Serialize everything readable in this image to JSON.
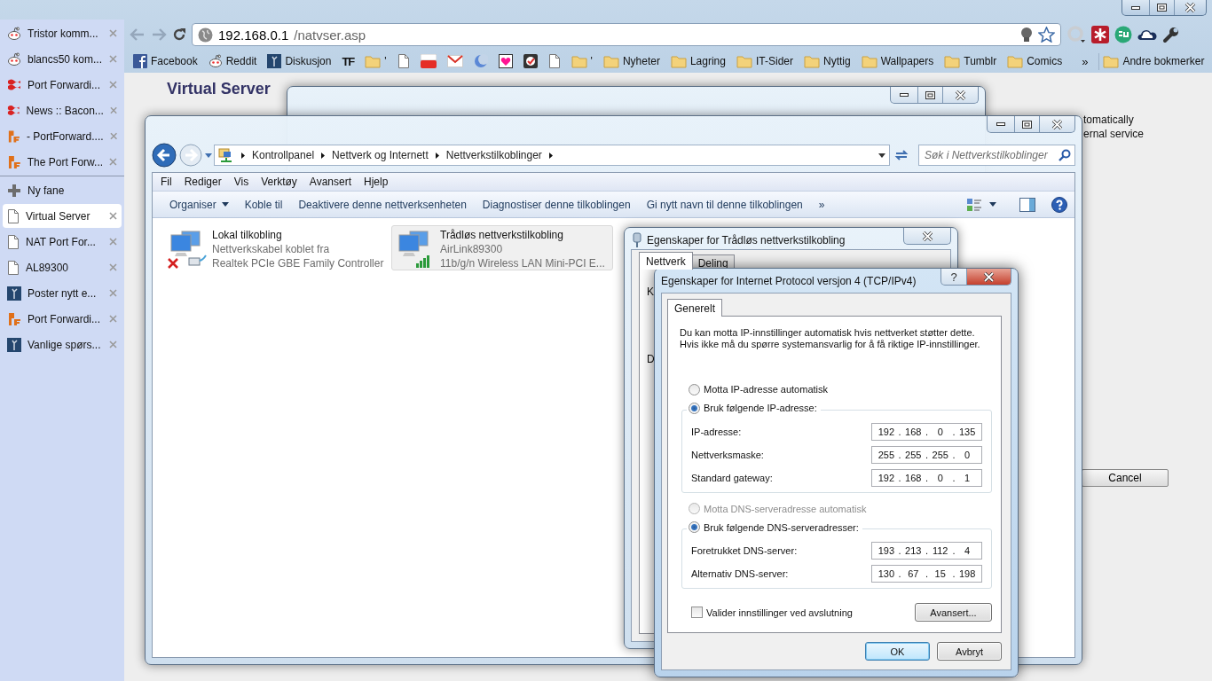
{
  "browser": {
    "tabs": [
      {
        "title": "Tristor komm...",
        "kind": "alien",
        "selected": false
      },
      {
        "title": "blancs50 kom...",
        "kind": "alien",
        "selected": false
      },
      {
        "title": "Port Forwardi...",
        "kind": "stripes",
        "selected": false
      },
      {
        "title": "News :: Bacon...",
        "kind": "stripes",
        "selected": false
      },
      {
        "title": "- PortForward....",
        "kind": "logo",
        "selected": false
      },
      {
        "title": "The Port Forw...",
        "kind": "logo",
        "selected": false
      }
    ],
    "new_tab": "Ny fane",
    "more_tabs": [
      {
        "title": "Virtual Server",
        "kind": "page",
        "selected": true
      },
      {
        "title": "NAT Port For...",
        "kind": "page",
        "selected": false
      },
      {
        "title": "AL89300",
        "kind": "page",
        "selected": false
      },
      {
        "title": "Poster nytt e...",
        "kind": "tile",
        "selected": false
      },
      {
        "title": "Port Forwardi...",
        "kind": "logo",
        "selected": false
      },
      {
        "title": "Vanlige spørs...",
        "kind": "tile",
        "selected": false
      }
    ],
    "url": {
      "host": "192.168.0.1",
      "path": "/natvser.asp"
    },
    "bookmarks": [
      {
        "label": "Facebook",
        "kind": "fb"
      },
      {
        "label": "Reddit",
        "kind": "alien"
      },
      {
        "label": "Diskusjon",
        "kind": "tile"
      },
      {
        "label": "TF",
        "kind": "text"
      },
      {
        "label": "'",
        "kind": "folder"
      },
      {
        "kind": "page"
      },
      {
        "kind": "video"
      },
      {
        "kind": "mail"
      },
      {
        "kind": "crescent"
      },
      {
        "kind": "heart"
      },
      {
        "kind": "check"
      },
      {
        "kind": "page"
      },
      {
        "label": "'",
        "kind": "folder"
      },
      {
        "label": "Nyheter",
        "kind": "folder"
      },
      {
        "label": "Lagring",
        "kind": "folder"
      },
      {
        "label": "IT-Sider",
        "kind": "folder"
      },
      {
        "label": "Nyttig",
        "kind": "folder"
      },
      {
        "label": "Wallpapers",
        "kind": "folder"
      },
      {
        "label": "Tumblr",
        "kind": "folder"
      },
      {
        "label": "Comics",
        "kind": "folder"
      }
    ],
    "bookmarks_more": "»",
    "other_bookmarks": "Andre bokmerker"
  },
  "page": {
    "heading": "Virtual Server",
    "lines": [
      "tomatically",
      "ernal service"
    ],
    "cancel_button": "Cancel"
  },
  "explorer": {
    "breadcrumb": [
      "Kontrollpanel",
      "Nettverk og Internett",
      "Nettverkstilkoblinger"
    ],
    "search_placeholder": "Søk i Nettverkstilkoblinger",
    "menu": [
      "Fil",
      "Rediger",
      "Vis",
      "Verktøy",
      "Avansert",
      "Hjelp"
    ],
    "organize": "Organiser",
    "commands": [
      "Koble til",
      "Deaktivere denne nettverksenheten",
      "Diagnostiser denne tilkoblingen",
      "Gi nytt navn til denne tilkoblingen"
    ],
    "commands_more": "»",
    "connections": [
      {
        "kind": "wired",
        "name": "Lokal tilkobling",
        "status": "Nettverkskabel koblet fra",
        "device": "Realtek PCIe GBE Family Controller",
        "disconnected": true,
        "selected": false
      },
      {
        "kind": "wireless",
        "name": "Trådløs nettverkstilkobling",
        "status": "AirLink89300",
        "device": "11b/g/n  Wireless LAN Mini-PCI E...",
        "disconnected": false,
        "selected": true
      }
    ]
  },
  "properties_dialog": {
    "title": "Egenskaper for Trådløs nettverkstilkobling",
    "tabs": [
      {
        "label": "Nettverk",
        "selected": true
      },
      {
        "label": "Deling",
        "selected": false
      }
    ],
    "labels": [
      "K",
      "D"
    ]
  },
  "ipv4_dialog": {
    "title": "Egenskaper for Internet Protocol versjon 4 (TCP/IPv4)",
    "help": "?",
    "tabs": [
      {
        "label": "Generelt",
        "selected": true
      }
    ],
    "intro": [
      "Du kan motta IP-innstillinger automatisk hvis nettverket støtter dette.",
      "Hvis ikke må du spørre systemansvarlig for å få riktige IP-innstillinger."
    ],
    "separator": ".",
    "sections": [
      {
        "auto": {
          "label": "Motta IP-adresse automatisk",
          "selected": false,
          "disabled": false
        },
        "manual": {
          "label": "Bruk følgende IP-adresse:",
          "selected": true,
          "disabled": false
        },
        "fields": [
          {
            "label": "IP-adresse:",
            "value": [
              "192",
              "168",
              "0",
              "135"
            ]
          },
          {
            "label": "Nettverksmaske:",
            "value": [
              "255",
              "255",
              "255",
              "0"
            ]
          },
          {
            "label": "Standard gateway:",
            "value": [
              "192",
              "168",
              "0",
              "1"
            ]
          }
        ]
      },
      {
        "auto": {
          "label": "Motta DNS-serveradresse automatisk",
          "selected": false,
          "disabled": true
        },
        "manual": {
          "label": "Bruk følgende DNS-serveradresser:",
          "selected": true,
          "disabled": false
        },
        "fields": [
          {
            "label": "Foretrukket DNS-server:",
            "value": [
              "193",
              "213",
              "112",
              "4"
            ]
          },
          {
            "label": "Alternativ DNS-server:",
            "value": [
              "130",
              "67",
              "15",
              "198"
            ]
          }
        ]
      }
    ],
    "validate": {
      "label": "Valider innstillinger ved avslutning",
      "checked": false
    },
    "advanced_button": "Avansert...",
    "buttons": [
      {
        "label": "OK",
        "default": true
      },
      {
        "label": "Avbryt",
        "default": false
      }
    ]
  }
}
